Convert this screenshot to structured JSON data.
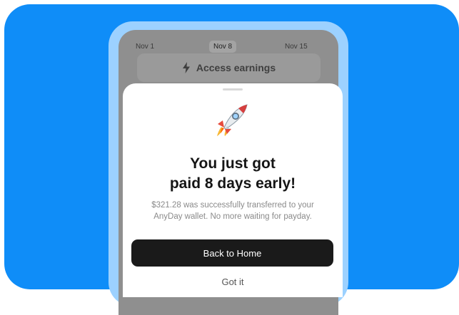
{
  "colors": {
    "background": "#0f8df8",
    "phone_frame": "#9cd1ff",
    "dimmed_screen": "#8f8f8f",
    "primary_button": "#1a1a1a"
  },
  "background_screen": {
    "dates": [
      "Nov 1",
      "Nov 8",
      "Nov 15"
    ],
    "selected_date": "Nov 8",
    "access_button": {
      "icon": "lightning-bolt-icon",
      "label": "Access earnings"
    }
  },
  "sheet": {
    "icon": "rocket-icon",
    "headline_line1": "You just got",
    "headline_line2": "paid 8 days early!",
    "description_line1": "$321.28 was successfully transferred to your",
    "description_line2": "AnyDay wallet. No more waiting for payday.",
    "primary_button": "Back to Home",
    "secondary_button": "Got it"
  }
}
